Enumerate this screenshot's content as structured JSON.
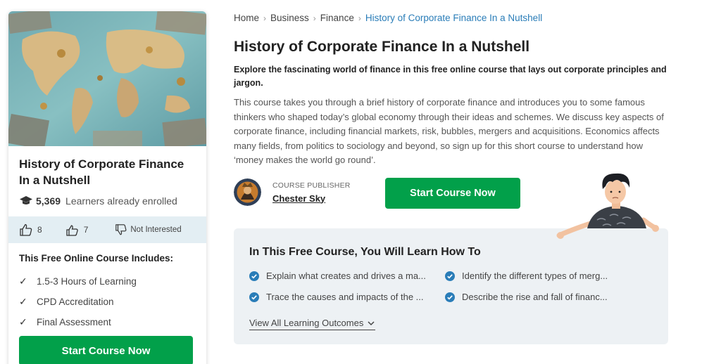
{
  "course": {
    "title": "History of Corporate Finance In a Nutshell",
    "enrolled_count": "5,369",
    "enrolled_label": "Learners already enrolled"
  },
  "votes": {
    "like_count": "8",
    "love_count": "7",
    "not_interested_label": "Not Interested"
  },
  "includes": {
    "title": "This Free Online Course Includes:",
    "items": [
      {
        "label": "1.5-3 Hours of Learning"
      },
      {
        "label": "CPD Accreditation"
      },
      {
        "label": "Final Assessment"
      }
    ]
  },
  "buttons": {
    "start_left": "Start Course Now",
    "start_main": "Start Course Now"
  },
  "breadcrumb": {
    "items": [
      {
        "label": "Home"
      },
      {
        "label": "Business"
      },
      {
        "label": "Finance"
      },
      {
        "label": "History of Corporate Finance In a Nutshell"
      }
    ]
  },
  "main": {
    "title": "History of Corporate Finance In a Nutshell",
    "lead": "Explore the fascinating world of finance in this free online course that lays out corporate principles and jargon.",
    "description": "This course takes you through a brief history of corporate finance and introduces you to some famous thinkers who shaped today’s global economy through their ideas and schemes. We discuss key aspects of corporate finance, including financial markets, risk, bubbles, mergers and acquisitions. Economics affects many fields, from politics to sociology and beyond, so sign up for this short course to understand how ‘money makes the world go round’."
  },
  "publisher": {
    "label": "COURSE PUBLISHER",
    "name": "Chester Sky"
  },
  "learn": {
    "title": "In This Free Course, You Will Learn How To",
    "outcomes": [
      {
        "label": "Explain what creates and drives a ma..."
      },
      {
        "label": "Identify the different types of merg..."
      },
      {
        "label": "Trace the causes and impacts of the ..."
      },
      {
        "label": "Describe the rise and fall of financ..."
      }
    ],
    "view_all": "View All Learning Outcomes"
  },
  "colors": {
    "accent_green": "#02a04a",
    "link_blue": "#2a7db8",
    "vote_bar_bg": "#e3eef3",
    "learn_box_bg": "#edf1f4"
  },
  "icons": [
    "graduation-cap-icon",
    "thumbs-up-icon",
    "heart-hand-icon",
    "thumbs-down-icon",
    "checkmark-icon",
    "check-circle-icon",
    "chevron-down-icon",
    "chevron-right-icon"
  ]
}
